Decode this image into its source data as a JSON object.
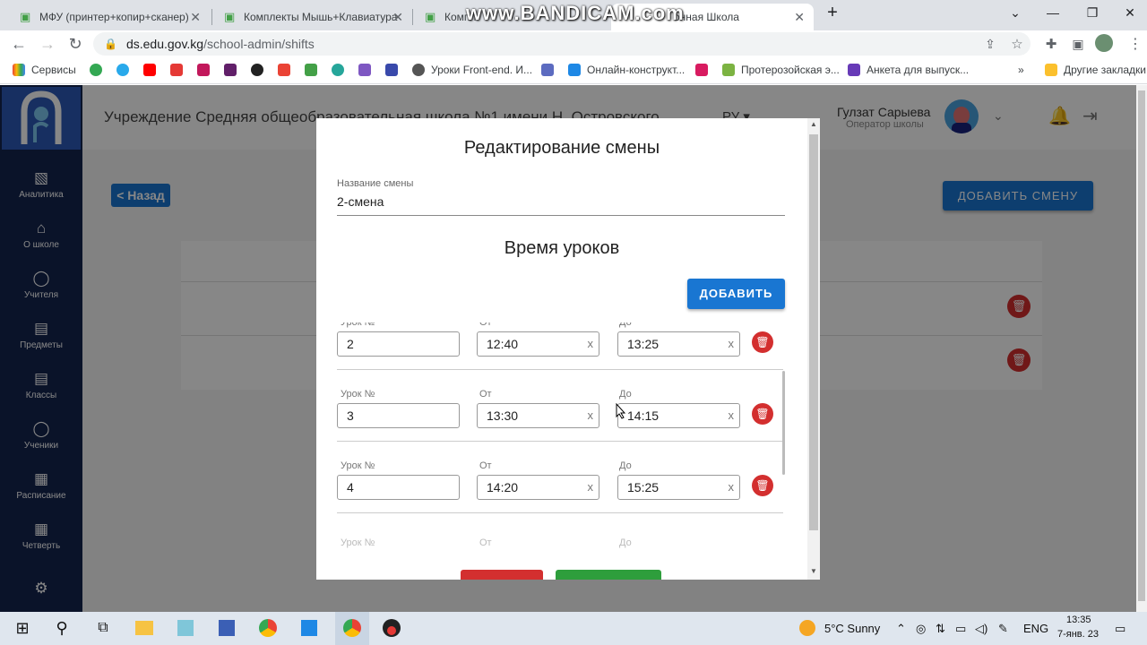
{
  "browser": {
    "tabs": [
      {
        "title": "МФУ (принтер+копир+сканер)"
      },
      {
        "title": "Комплекты Мышь+Клавиатура"
      },
      {
        "title": "Компл"
      },
      {
        "title": "онная Школа"
      }
    ],
    "watermark": "www.BANDICAM.com",
    "url_host": "ds.edu.gov.kg",
    "url_path": "/school-admin/shifts",
    "bookmarks": [
      "Сервисы",
      "Уроки Front-end. И...",
      "Онлайн-конструкт...",
      "Протерозойская э...",
      "Анкета для выпуск...",
      "Другие закладки"
    ]
  },
  "header": {
    "institution": "Учреждение Средняя общеобразовательная школа №1 имени Н. Островского",
    "language": "РУ",
    "user_name": "Гулзат Сарыева",
    "user_role": "Оператор школы"
  },
  "sidebar": {
    "items": [
      {
        "label": "Аналитика",
        "icon": "bar-chart-icon"
      },
      {
        "label": "О школе",
        "icon": "home-icon"
      },
      {
        "label": "Учителя",
        "icon": "user-icon"
      },
      {
        "label": "Предметы",
        "icon": "book-icon"
      },
      {
        "label": "Классы",
        "icon": "book-icon"
      },
      {
        "label": "Ученики",
        "icon": "users-icon"
      },
      {
        "label": "Расписание",
        "icon": "calendar-icon"
      },
      {
        "label": "Четверть",
        "icon": "calendar-icon"
      }
    ]
  },
  "page": {
    "back_label": "< Назад",
    "add_shift_label": "ДОБАВИТЬ СМЕНУ"
  },
  "modal": {
    "title": "Редактирование смены",
    "name_label": "Название смены",
    "name_value": "2-смена",
    "lessons_title": "Время уроков",
    "add_label": "ДОБАВИТЬ",
    "field_labels": {
      "lesson": "Урок №",
      "from": "От",
      "to": "До"
    },
    "clear_glyph": "x",
    "lessons": [
      {
        "number": "2",
        "from": "12:40",
        "to": "13:25"
      },
      {
        "number": "3",
        "from": "13:30",
        "to": "14:15"
      },
      {
        "number": "4",
        "from": "14:20",
        "to": "15:25"
      }
    ]
  },
  "taskbar": {
    "weather": "5°C  Sunny",
    "lang": "ENG",
    "time": "13:35",
    "date": "7-янв. 23"
  },
  "colors": {
    "primary": "#1976d2",
    "danger": "#d32f2f",
    "success": "#2e9e3c",
    "sidebar": "#14244f"
  }
}
